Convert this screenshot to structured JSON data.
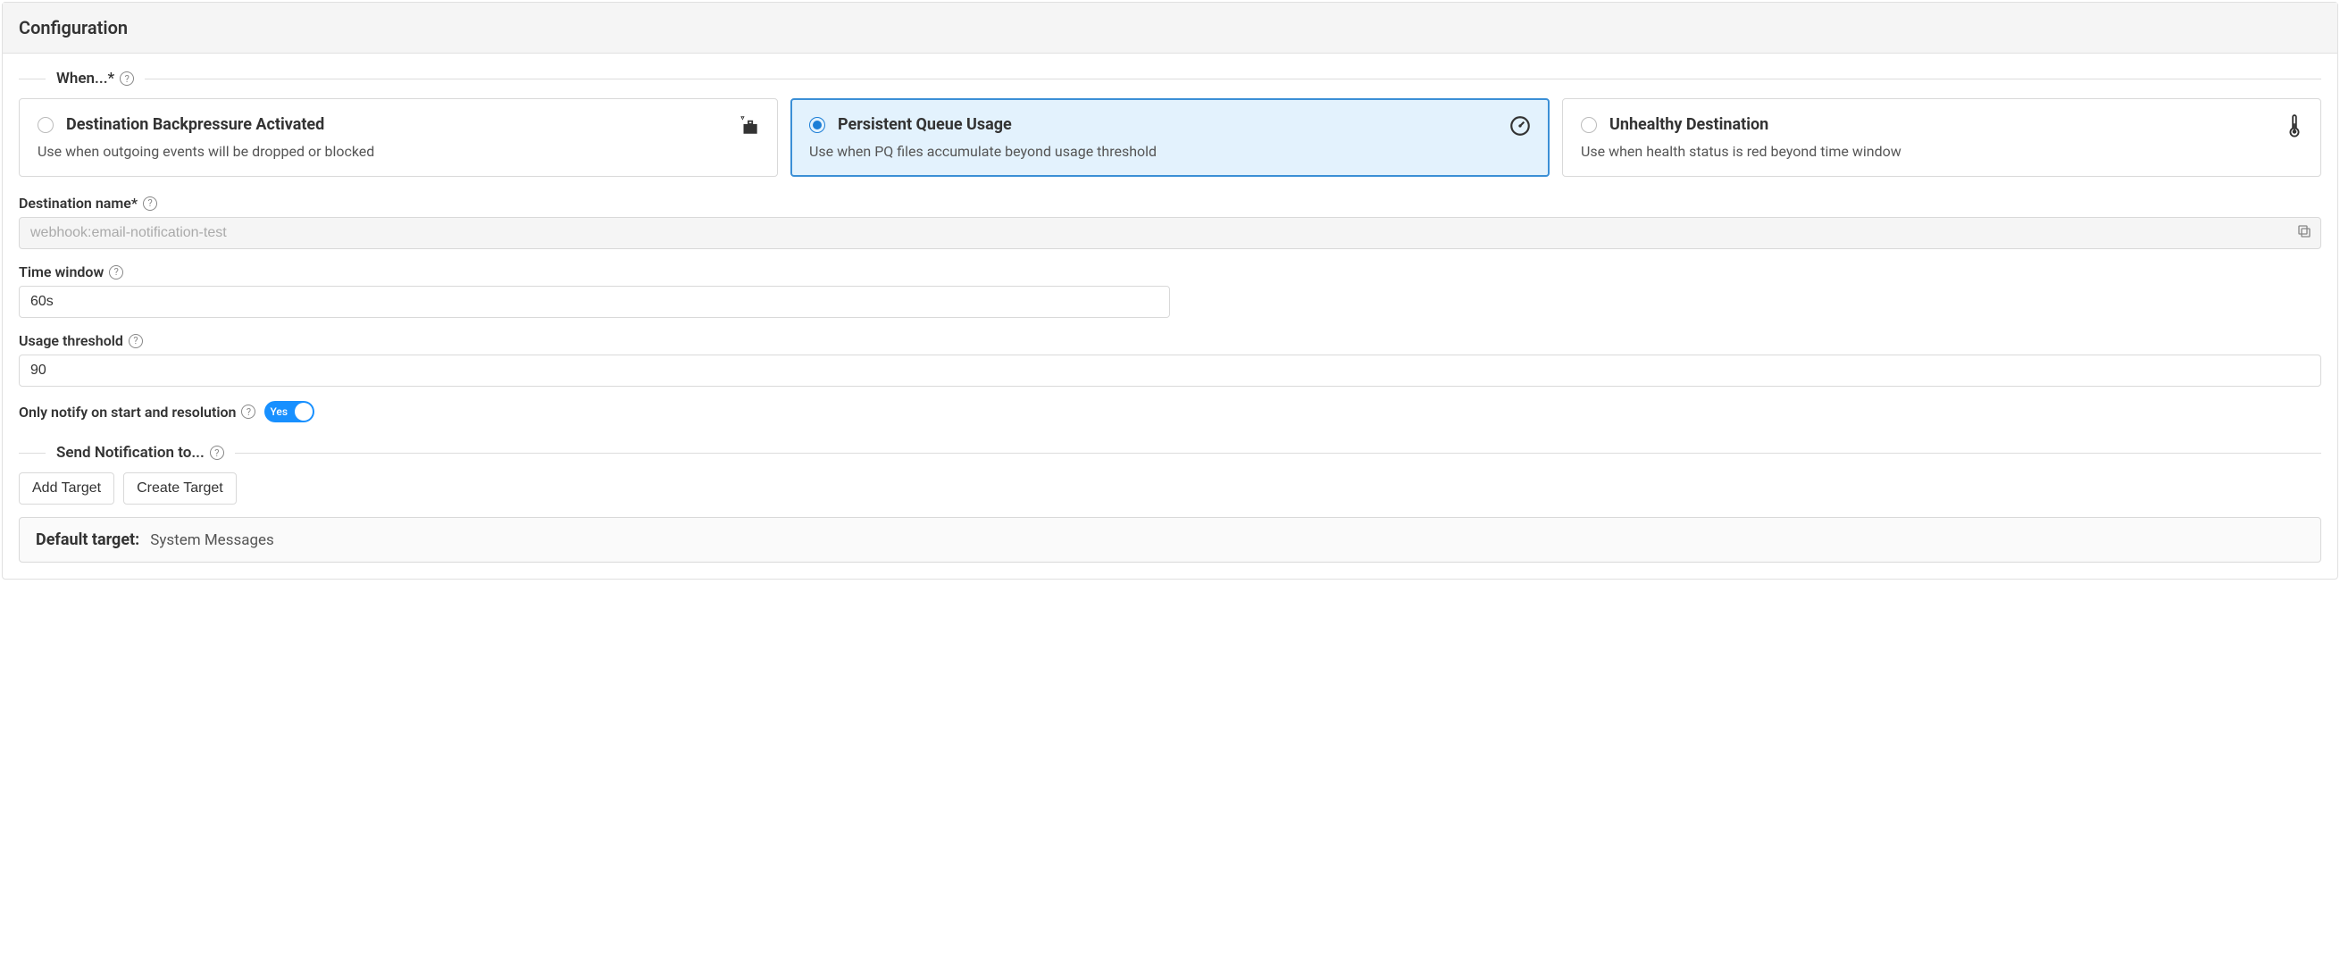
{
  "panel": {
    "title": "Configuration"
  },
  "when": {
    "legend": "When...*",
    "options": [
      {
        "title": "Destination Backpressure Activated",
        "desc": "Use when outgoing events will be dropped or blocked"
      },
      {
        "title": "Persistent Queue Usage",
        "desc": "Use when PQ files accumulate beyond usage threshold"
      },
      {
        "title": "Unhealthy Destination",
        "desc": "Use when health status is red beyond time window"
      }
    ]
  },
  "fields": {
    "destination_name": {
      "label": "Destination name*",
      "value": "webhook:email-notification-test"
    },
    "time_window": {
      "label": "Time window",
      "value": "60s"
    },
    "usage_threshold": {
      "label": "Usage threshold",
      "value": "90"
    },
    "notify_toggle": {
      "label": "Only notify on start and resolution",
      "state": "Yes"
    }
  },
  "notify": {
    "legend": "Send Notification to...",
    "add_target": "Add Target",
    "create_target": "Create Target",
    "default_label": "Default target:",
    "default_value": "System Messages"
  }
}
